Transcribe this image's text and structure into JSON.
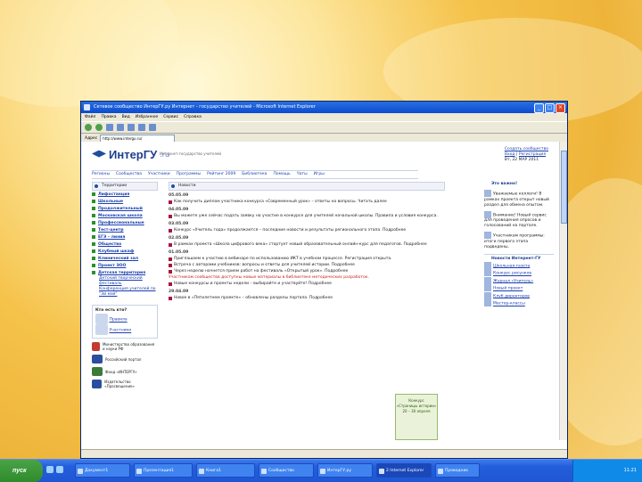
{
  "window": {
    "title": "Сетевое сообщество ИнтерГУ.ру Интернет - государство учителей - Microsoft Internet Explorer",
    "menu": [
      "Файл",
      "Правка",
      "Вид",
      "Избранное",
      "Сервис",
      "Справка"
    ],
    "address_label": "Адрес",
    "address": "http://www.intergu.ru/"
  },
  "site": {
    "logo": "ИнтерГУ",
    "logo_suffix": ".ru",
    "slogan": "Интернет-государство учителей",
    "top_right": [
      "Создать сообщество",
      "Вход",
      "Регистрация"
    ],
    "date_line": "Вт, 22 МАР 2011"
  },
  "nav": [
    "Регионы",
    "Сообщества",
    "Участники",
    "Программы",
    "Рейтинг 2009",
    "Библиотека",
    "Помощь",
    "Чаты",
    "Игры"
  ],
  "left": {
    "header": "Территории",
    "items": [
      "Лифостанция",
      "Школьные",
      "Продолжительный",
      "Московская школа",
      "Профессиональные",
      "Тест-центр",
      "ЕГЭ – линия",
      "Общество",
      "Клубный шкаф",
      "Клинический зал",
      "Проект ЭОО",
      "Детская территория"
    ],
    "subs": [
      "Детский творческий фестиваль",
      "Конференция учителей по \"Эй мэй\""
    ],
    "box_title": "Кто есть кто?",
    "box_links": [
      "Правила",
      "Участники"
    ],
    "badges": [
      "Министерство образования и науки РФ",
      "Российский портал",
      "Фонд «ИНТЕРГУ»",
      "Издательство «Просвещение»"
    ]
  },
  "center": {
    "header": "Новости",
    "dates": [
      "05.05.09",
      "04.05.09",
      "03.05.09",
      "02.05.09",
      "01.05.09",
      "29.04.09"
    ],
    "news": [
      "Как получить диплом участника конкурса «Современный урок» – ответы на вопросы. Читать далее",
      "Вы можете уже сейчас подать заявку на участие в конкурсе для учителей начальной школы. Правила и условия конкурса.",
      "Конкурс «Учитель года» продолжается – последние новости и результаты регионального этапа. Подробнее",
      "В рамках проекта «Школа цифрового века» стартует новый образовательный онлайн-курс для педагогов. Подробнее",
      "Приглашаем к участию в вебинаре по использованию ИКТ в учебном процессе. Регистрация открыта.",
      "Встреча с авторами учебников: вопросы и ответы для учителей истории. Подробнее",
      "Через неделю начнется прием работ на фестиваль «Открытый урок». Подробнее",
      "Участникам сообщества доступны новые материалы в библиотеке методических разработок.",
      "Новые конкурсы и проекты недели – выбирайте и участвуйте! Подробнее",
      "Новое в «Пятилетнем проекте» – обновлены разделы портала. Подробнее"
    ],
    "promo": [
      "Конкурс",
      "«Страницы истории»",
      "20 – 30 апреля"
    ]
  },
  "right": {
    "header": "Это важно!",
    "items": [
      "Уважаемые коллеги! В рамках проекта открыт новый раздел для обмена опытом.",
      "Внимание! Новый сервис для проведения опросов и голосований на портале.",
      "Участникам программы: итоги первого этапа подведены."
    ],
    "partners_title": "Новости Интернет-ГУ",
    "partners": [
      "Школьная газета",
      "Конкурс рисунков",
      "Журнал «Учитель»",
      "Новый проект",
      "Клуб директоров",
      "Мастер-классы"
    ]
  },
  "taskbar": {
    "start": "пуск",
    "tasks": [
      "Документ1",
      "Презентация1",
      "Книга1",
      "Сообщество",
      "ИнтерГУ.ру",
      "2 Internet Explorer",
      "Проводник"
    ],
    "time": "11:21"
  }
}
